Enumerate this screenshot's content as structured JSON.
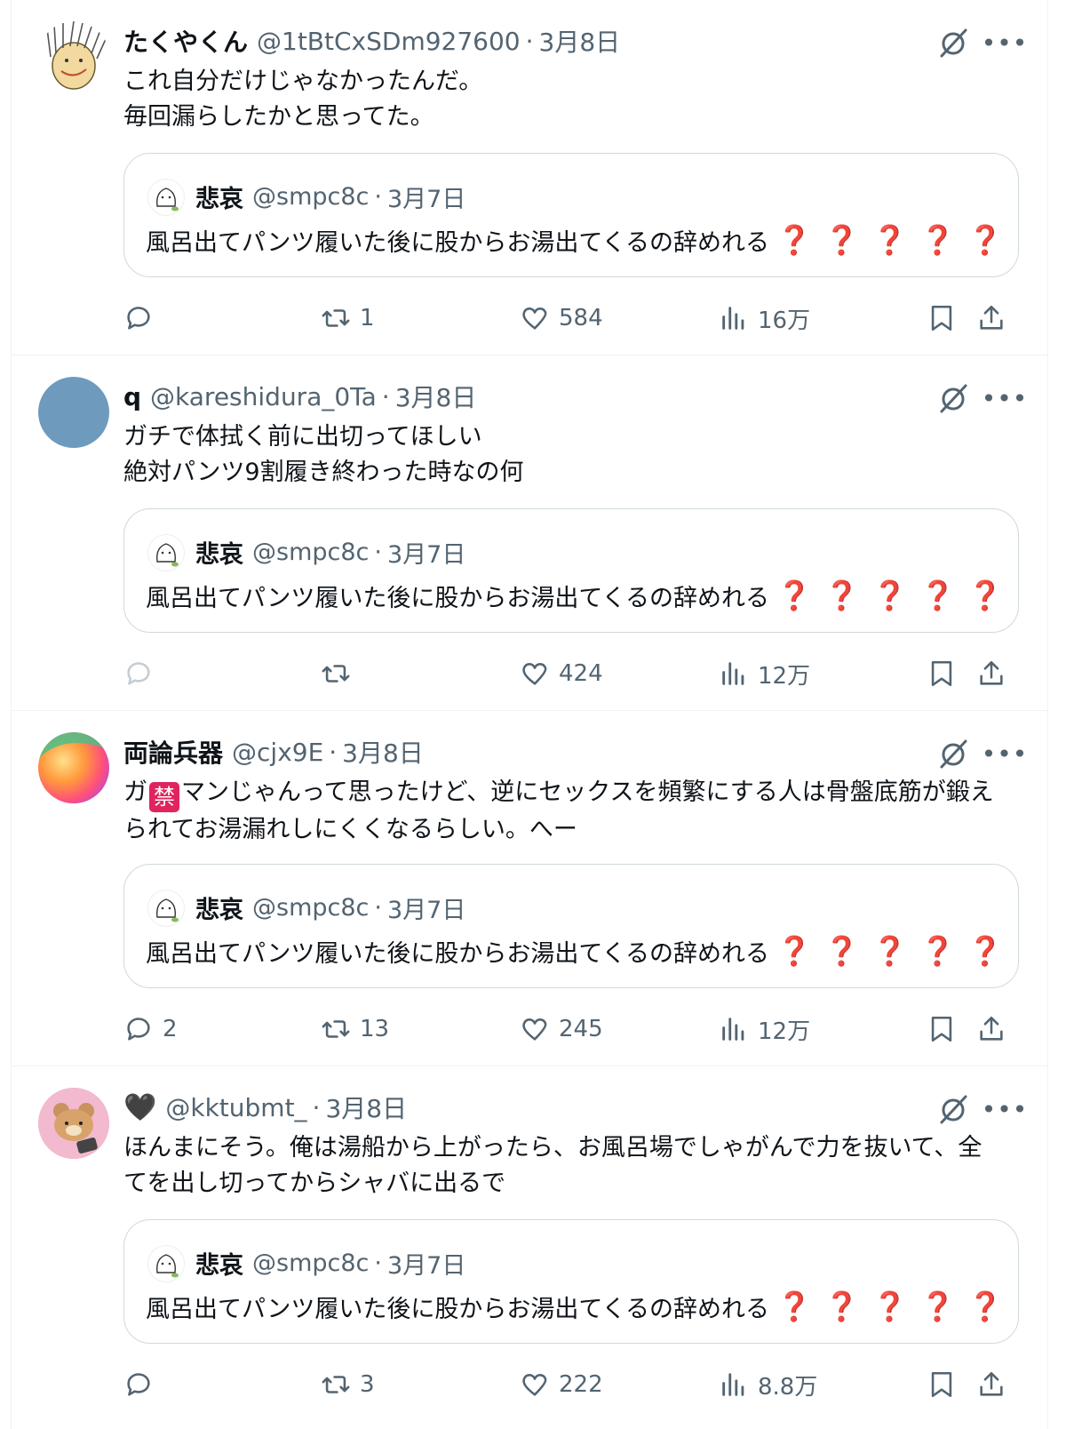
{
  "tweets": [
    {
      "name": "たくやくん",
      "handle": "@1tBtCxSDm927600",
      "date": "3月8日",
      "text_lines": [
        "これ自分だけじゃなかったんだ。",
        "毎回漏らしたかと思ってた。"
      ],
      "avatar": "hand-drawn-face",
      "quote": {
        "name": "悲哀",
        "handle": "@smpc8c",
        "date": "3月7日",
        "text": "風呂出てパンツ履いた後に股からお湯出てくるの辞めれる",
        "emoji": "❓❓❓❓❓"
      },
      "reply_count": "",
      "retweet_count": "1",
      "like_count": "584",
      "view_count": "16万"
    },
    {
      "name": "q",
      "handle": "@kareshidura_0Ta",
      "date": "3月8日",
      "text_lines": [
        "ガチで体拭く前に出切ってほしい",
        "絶対パンツ9割履き終わった時なの何"
      ],
      "avatar": "solid-blue",
      "quote": {
        "name": "悲哀",
        "handle": "@smpc8c",
        "date": "3月7日",
        "text": "風呂出てパンツ履いた後に股からお湯出てくるの辞めれる",
        "emoji": "❓❓❓❓❓"
      },
      "reply_count": "",
      "retweet_count": "",
      "like_count": "424",
      "view_count": "12万"
    },
    {
      "name": "両論兵器",
      "handle": "@cjx9E",
      "date": "3月8日",
      "text_line1_pre": "ガ",
      "text_line1_ban": "禁",
      "text_line1_post": "マンじゃんって思ったけど、逆にセックスを頻繁にする人は骨盤底筋が鍛え",
      "text_line2": "られてお湯漏れしにくくなるらしい。へー",
      "avatar": "gradient-swirl",
      "quote": {
        "name": "悲哀",
        "handle": "@smpc8c",
        "date": "3月7日",
        "text": "風呂出てパンツ履いた後に股からお湯出てくるの辞めれる",
        "emoji": "❓❓❓❓❓"
      },
      "reply_count": "2",
      "retweet_count": "13",
      "like_count": "245",
      "view_count": "12万"
    },
    {
      "name": "🖤",
      "handle": "@kktubmt_",
      "date": "3月8日",
      "text_lines": [
        "ほんまにそう。俺は湯船から上がったら、お風呂場でしゃがんで力を抜いて、全",
        "てを出し切ってからシャバに出るで"
      ],
      "avatar": "bear-character",
      "quote": {
        "name": "悲哀",
        "handle": "@smpc8c",
        "date": "3月7日",
        "text": "風呂出てパンツ履いた後に股からお湯出てくるの辞めれる",
        "emoji": "❓❓❓❓❓"
      },
      "reply_count": "",
      "retweet_count": "3",
      "like_count": "222",
      "view_count": "8.8万"
    }
  ],
  "colors": {
    "text": "#0f1419",
    "muted": "#536471",
    "border": "#cfd9de",
    "divider": "#eff3f4",
    "question_mark": "#d11c30",
    "avatar_blue": "#6e9bbd"
  }
}
